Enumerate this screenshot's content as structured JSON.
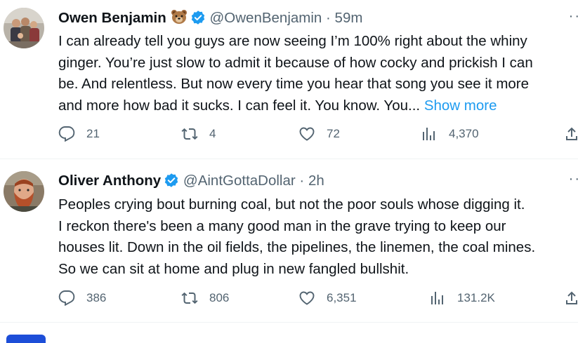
{
  "tweets": [
    {
      "author": "Owen Benjamin",
      "handle": "@OwenBenjamin",
      "separator": "·",
      "time": "59m",
      "lines": [
        "I can already tell you guys are now seeing I’m 100% right about the whiny",
        "ginger. You’re just slow to admit it because of how cocky and prickish I can",
        "be. And relentless. But now every time you hear that song you see it more",
        "and more how bad it sucks. I can feel it. You know. You... "
      ],
      "show_more": "Show more",
      "replies": "21",
      "retweets": "4",
      "likes": "72",
      "views": "4,370",
      "more_icon": "more-horizontal-icon",
      "name_emoji": "bear-face-icon"
    },
    {
      "author": "Oliver Anthony",
      "handle": "@AintGottaDollar",
      "separator": "·",
      "time": "2h",
      "lines": [
        "Peoples crying bout burning coal, but not the poor souls whose digging it.",
        "I reckon there's been a many good man in the grave trying to keep our",
        "houses lit. Down in the oil fields, the pipelines, the linemen, the coal mines.",
        "So we can sit at home and plug in new fangled bullshit."
      ],
      "replies": "386",
      "retweets": "806",
      "likes": "6,351",
      "views": "131.2K",
      "more_icon": "more-horizontal-icon"
    }
  ],
  "colors": {
    "text": "#0f1419",
    "secondary": "#536471",
    "link": "#1d9bf0",
    "verified": "#1d9bf0",
    "divider": "#eff3f4"
  }
}
